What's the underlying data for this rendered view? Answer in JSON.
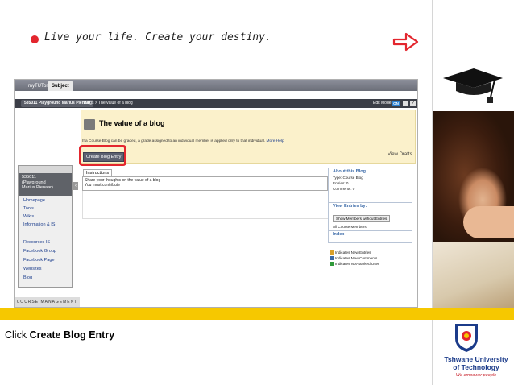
{
  "slide": {
    "tagline": "Live your life. Create your destiny.",
    "caption_prefix": "Click ",
    "caption_bold": "Create Blog Entry",
    "logo_name_line1": "Tshwane University",
    "logo_name_line2": "of Technology",
    "logo_slogan": "We empower people"
  },
  "colors": {
    "accent_red": "#e3262e",
    "band_yellow": "#f6c800",
    "brand_blue": "#1b3b8a"
  },
  "icons": [
    "arrow-right-icon",
    "graduation-cap-icon",
    "blog-icon",
    "tut-logo-icon"
  ],
  "app": {
    "tabs": [
      "myTUTor",
      "Subject"
    ],
    "course_pill": "535011 Playground Marius Pienaar",
    "breadcrumb": "Blogs  >  The value of a blog",
    "edit_mode_label": "Edit Mode is:",
    "edit_mode_value": "ON"
  },
  "menu": {
    "course_name_1": "535011",
    "course_name_2": "(Playground",
    "course_name_3": "Marius Pienaar)",
    "items": [
      "Homepage",
      "Tools",
      "Wikis",
      "Information & IS",
      "Resources IS",
      "Facebook Group",
      "Facebook Page",
      "Websites",
      "Blog"
    ],
    "course_management": "COURSE MANAGEMENT"
  },
  "blog": {
    "title": "The value of a blog",
    "note": "If a Course Blog can be graded, a grade assigned to an individual member is applied only to that individual.",
    "note_link": "More Help",
    "create_button": "Create Blog Entry",
    "view_drafts": "View Drafts",
    "instructions_tab": "Instructions",
    "instructions_line1": "Share your thoughts on the value of a blog",
    "instructions_line2": "You must contribute"
  },
  "sidebar": {
    "about_header": "About this Blog",
    "type": "Type: Course Blog",
    "entries": "Entries: 0",
    "comments": "Comments: 0",
    "view_header": "View Entries by:",
    "show_button": "Show Members without Entries",
    "all_members": "All Course Members",
    "index_header": "Index",
    "legend": [
      "Indicates New Entries",
      "Indicates New Comments",
      "Indicates Not-Marked User"
    ]
  }
}
